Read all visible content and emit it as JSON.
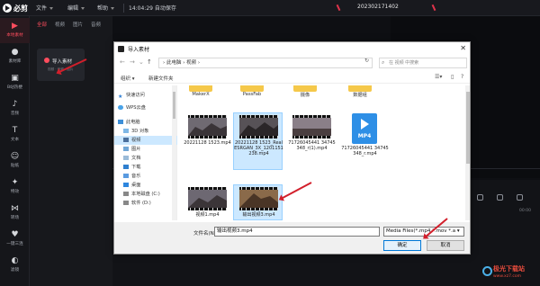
{
  "app": {
    "logo": "必剪",
    "menus": [
      "文件",
      "编辑",
      "帮助"
    ],
    "autosave": "14:04:29 自动保存",
    "project_name": "202302171402",
    "accent_color": "#ff4d5e"
  },
  "sidebar": {
    "items": [
      {
        "label": "本地素材",
        "icon": "import-icon"
      },
      {
        "label": "素材库",
        "icon": "library-icon"
      },
      {
        "label": "B站热梗",
        "icon": "bilibili-icon"
      },
      {
        "label": "音频",
        "icon": "music-icon"
      },
      {
        "label": "文本",
        "icon": "text-icon"
      },
      {
        "label": "贴纸",
        "icon": "sticker-icon"
      },
      {
        "label": "特效",
        "icon": "effects-icon"
      },
      {
        "label": "转场",
        "icon": "transition-icon"
      },
      {
        "label": "一键三连",
        "icon": "triple-icon"
      },
      {
        "label": "滤镜",
        "icon": "filter-icon"
      }
    ]
  },
  "media_panel": {
    "tabs": [
      "全部",
      "视频",
      "图片",
      "音频"
    ],
    "import_title": "导入素材",
    "import_sub": "视频 · 音频 · 图片"
  },
  "dialog": {
    "title": "导入素材",
    "address": "›  此电脑  ›  视频  ›",
    "search_placeholder": "在 视频 中搜索",
    "toolbar": {
      "organize": "组织 ▾",
      "new_folder": "新建文件夹"
    },
    "nav": [
      {
        "label": "快速访问",
        "icon": "star-icon"
      },
      {
        "label": "WPS云盘",
        "icon": "cloud-icon"
      },
      {
        "label": "此电脑",
        "icon": "computer-icon"
      },
      {
        "label": "3D 对象",
        "icon": "cube-icon"
      },
      {
        "label": "视频",
        "icon": "video-folder-icon",
        "active": true
      },
      {
        "label": "图片",
        "icon": "picture-icon"
      },
      {
        "label": "文档",
        "icon": "document-icon"
      },
      {
        "label": "下载",
        "icon": "download-icon"
      },
      {
        "label": "音乐",
        "icon": "music-note-icon"
      },
      {
        "label": "桌面",
        "icon": "desktop-icon"
      },
      {
        "label": "本地磁盘 (C:)",
        "icon": "drive-icon"
      },
      {
        "label": "软件 (D:)",
        "icon": "drive-icon"
      }
    ],
    "folders": [
      "MakerX",
      "PassFab",
      "摄像",
      "数据组"
    ],
    "files": [
      {
        "name": "20221128 1523.mp4",
        "kind": "video"
      },
      {
        "name": "20221128 1523_RealESRGAN_3X_1201151238.mp4",
        "kind": "video",
        "selected": true
      },
      {
        "name": "71726045441 34745348_r(1).mp4",
        "kind": "video"
      },
      {
        "name": "71726045441 34745348_r.mp4",
        "kind": "mp4"
      },
      {
        "name": "视频1.mp4",
        "kind": "video"
      },
      {
        "name": "输出视频3.mp4",
        "kind": "video",
        "selected": true
      }
    ],
    "mp4_label": "MP4",
    "filename_label": "文件名(N):",
    "filename_value": "输出视频3.mp4",
    "filetype_value": "Media Files(*.mp4 *.mov *.a ▾",
    "open_label": "确定",
    "cancel_label": "取消"
  },
  "timeline": {
    "time": "00:00"
  },
  "watermark": {
    "text": "极光下载站",
    "url": "www.xz7.com"
  }
}
